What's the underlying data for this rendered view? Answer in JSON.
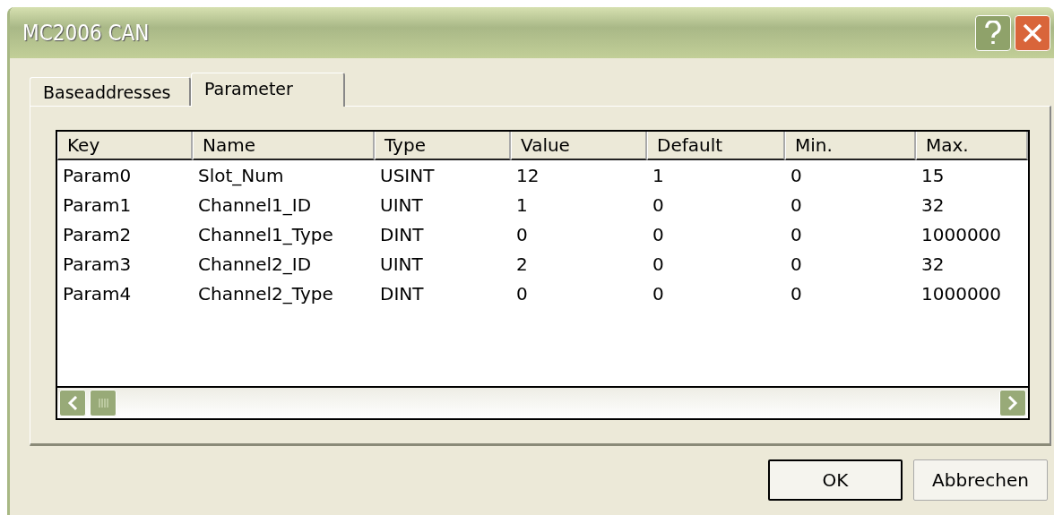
{
  "window": {
    "title": "MC2006 CAN"
  },
  "tabs": [
    {
      "label": "Baseaddresses",
      "selected": false
    },
    {
      "label": "Parameter",
      "selected": true
    }
  ],
  "table": {
    "columns": [
      "Key",
      "Name",
      "Type",
      "Value",
      "Default",
      "Min.",
      "Max."
    ],
    "rows": [
      [
        "Param0",
        "Slot_Num",
        "USINT",
        "12",
        "1",
        "0",
        "15"
      ],
      [
        "Param1",
        "Channel1_ID",
        "UINT",
        "1",
        "0",
        "0",
        "32"
      ],
      [
        "Param2",
        "Channel1_Type",
        "DINT",
        "0",
        "0",
        "0",
        "1000000"
      ],
      [
        "Param3",
        "Channel2_ID",
        "UINT",
        "2",
        "0",
        "0",
        "32"
      ],
      [
        "Param4",
        "Channel2_Type",
        "DINT",
        "0",
        "0",
        "0",
        "1000000"
      ]
    ]
  },
  "buttons": [
    {
      "label": "OK",
      "default": true
    },
    {
      "label": "Abbrechen",
      "default": false
    }
  ]
}
